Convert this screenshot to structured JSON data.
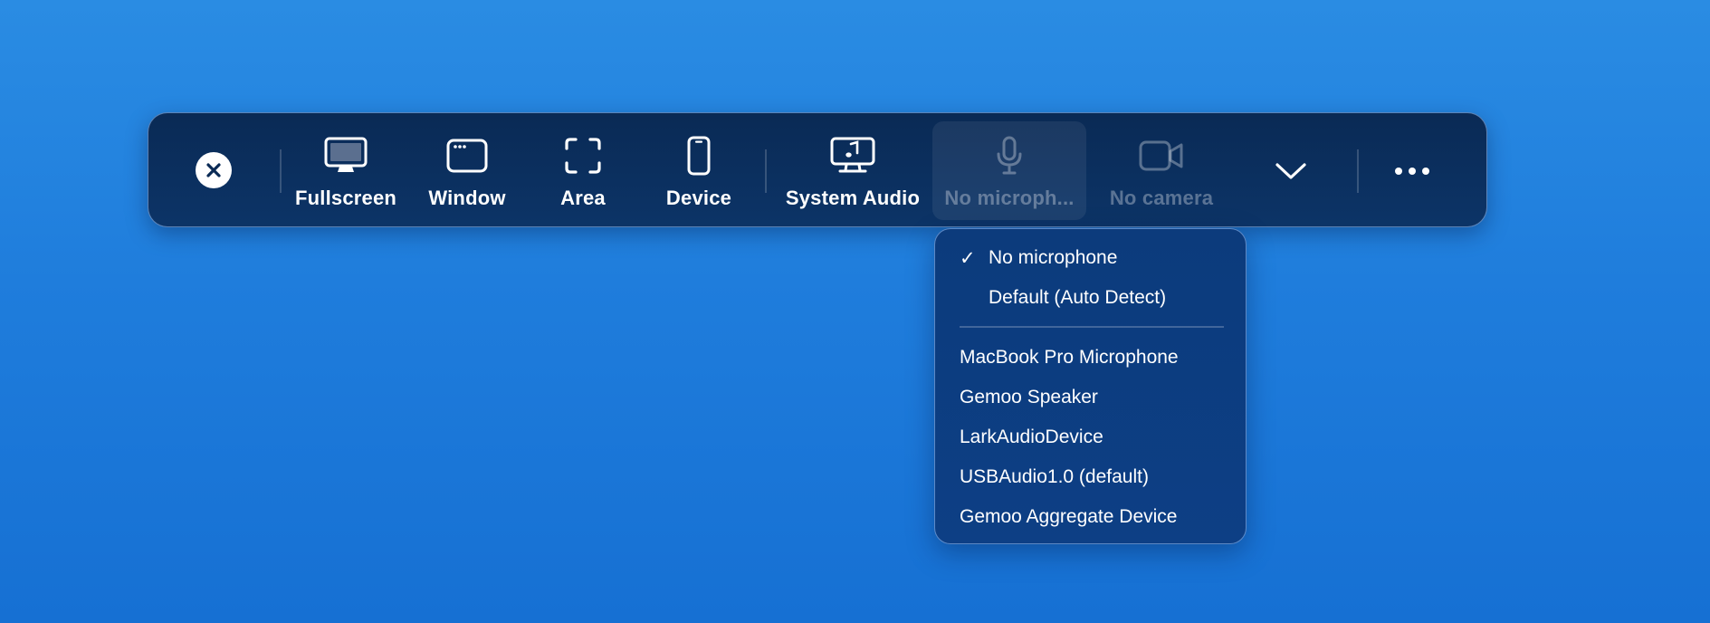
{
  "toolbar": {
    "tools": [
      {
        "label": "Fullscreen",
        "icon": "monitor-icon"
      },
      {
        "label": "Window",
        "icon": "window-icon"
      },
      {
        "label": "Area",
        "icon": "area-select-icon"
      },
      {
        "label": "Device",
        "icon": "phone-icon"
      },
      {
        "label": "System Audio",
        "icon": "monitor-music-icon"
      },
      {
        "label": "No microph...",
        "icon": "microphone-icon",
        "state": "disabled"
      },
      {
        "label": "No camera",
        "icon": "camera-icon",
        "state": "disabled"
      }
    ],
    "close_icon": "close-icon",
    "chevron_icon": "chevron-down-icon",
    "more_icon": "more-dots-icon"
  },
  "mic_menu": {
    "checkmark": "✓",
    "primary_items": [
      {
        "label": "No microphone",
        "checked": true
      },
      {
        "label": "Default (Auto Detect)",
        "checked": false
      }
    ],
    "device_items": [
      {
        "label": "MacBook Pro Microphone"
      },
      {
        "label": "Gemoo Speaker"
      },
      {
        "label": "LarkAudioDevice"
      },
      {
        "label": "USBAudio1.0 (default)"
      },
      {
        "label": "Gemoo Aggregate Device"
      }
    ]
  },
  "colors": {
    "background": "#2a8ce3",
    "toolbar": "#0a2a55",
    "menu": "#0c3b7c",
    "text": "#ffffff"
  }
}
